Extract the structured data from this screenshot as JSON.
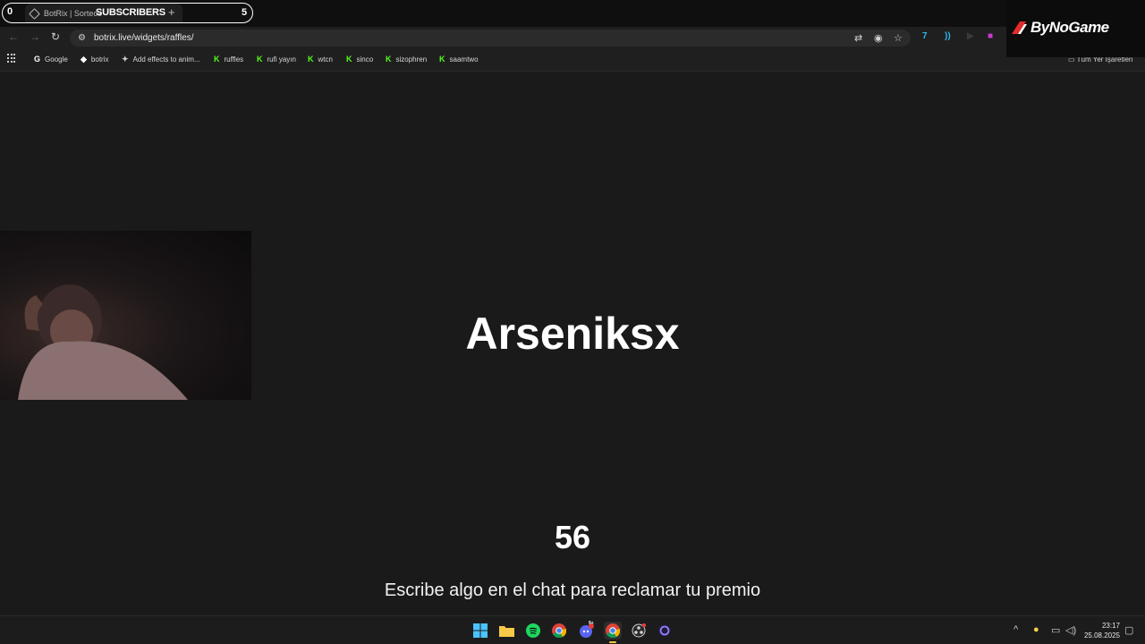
{
  "browser": {
    "tab": {
      "title": "BotRix | Sorteos",
      "favicon": "diamond-icon"
    },
    "url": "botrix.live/widgets/raffles/",
    "bookmarks": [
      {
        "label": "Google",
        "icon": "google-icon"
      },
      {
        "label": "botrix",
        "icon": "diamond-icon"
      },
      {
        "label": "Add effects to anim...",
        "icon": "extension-icon"
      },
      {
        "label": "ruffles",
        "icon": "kick-icon"
      },
      {
        "label": "rufi yayın",
        "icon": "kick-icon"
      },
      {
        "label": "wtcn",
        "icon": "kick-icon"
      },
      {
        "label": "sinco",
        "icon": "kick-icon"
      },
      {
        "label": "sizophren",
        "icon": "kick-icon"
      },
      {
        "label": "saamtwo",
        "icon": "kick-icon"
      }
    ],
    "all_bookmarks_label": "Tüm Yer İşaretleri"
  },
  "subscribers_overlay": {
    "left_count": "0",
    "title": "SUBSCRIBERS",
    "right_count": "5"
  },
  "logo_overlay": {
    "text": "ByNoGame"
  },
  "raffle": {
    "winner": "Arseniksx",
    "countdown": "56",
    "instruction": "Escribe algo en el chat para reclamar tu premio"
  },
  "taskbar": {
    "apps": [
      "windows-start-icon",
      "file-explorer-icon",
      "spotify-icon",
      "chrome-icon",
      "discord-icon",
      "chrome-active-icon",
      "obs-icon",
      "app-icon"
    ],
    "discord_badge": "9+",
    "time": "23:17",
    "date": "25.08.2025"
  },
  "colors": {
    "page_bg": "#1a1a1b",
    "kick_green": "#53fc18",
    "text_white": "#ffffff"
  }
}
